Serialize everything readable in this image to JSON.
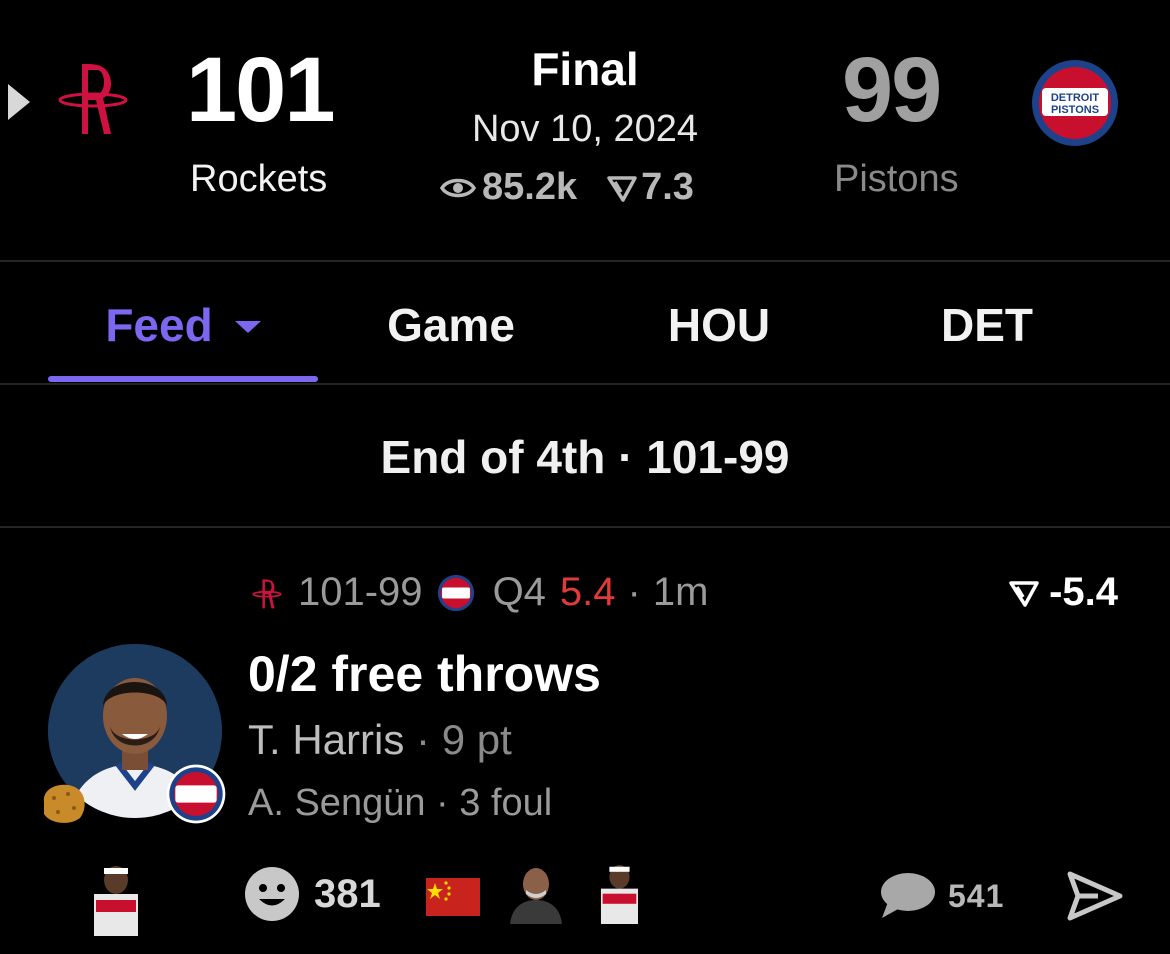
{
  "scoreboard": {
    "home": {
      "score": "101",
      "name": "Rockets",
      "logo_text": "R"
    },
    "status": "Final",
    "date": "Nov 10, 2024",
    "views": "85.2k",
    "rating": "7.3",
    "away": {
      "score": "99",
      "name": "Pistons",
      "logo_text_1": "DETROIT",
      "logo_text_2": "PISTONS"
    }
  },
  "tabs": [
    {
      "label": "Feed",
      "active": true
    },
    {
      "label": "Game"
    },
    {
      "label": "HOU"
    },
    {
      "label": "DET"
    }
  ],
  "period_header": "End of 4th · 101-99",
  "play": {
    "score": "101-99",
    "quarter": "Q4",
    "clock": "5.4",
    "sep": "·",
    "ago": "1m",
    "delta": "-5.4",
    "title": "0/2 free throws",
    "player": "T. Harris",
    "player_stat": "9 pt",
    "secondary_player": "A. Sengün",
    "secondary_stat": "3 foul"
  },
  "reactions": {
    "count": "381",
    "comments": "541"
  },
  "colors": {
    "accent": "#7b67f0",
    "rockets_red": "#ce1141",
    "pistons_blue": "#1d428a",
    "clock_red": "#e03a3a",
    "background": "#000000"
  },
  "icons": [
    "expand-arrow-icon",
    "rockets-logo-icon",
    "pistons-logo-icon",
    "eye-icon",
    "rating-icon",
    "smile-icon",
    "china-flag-icon",
    "comment-icon",
    "send-icon"
  ]
}
